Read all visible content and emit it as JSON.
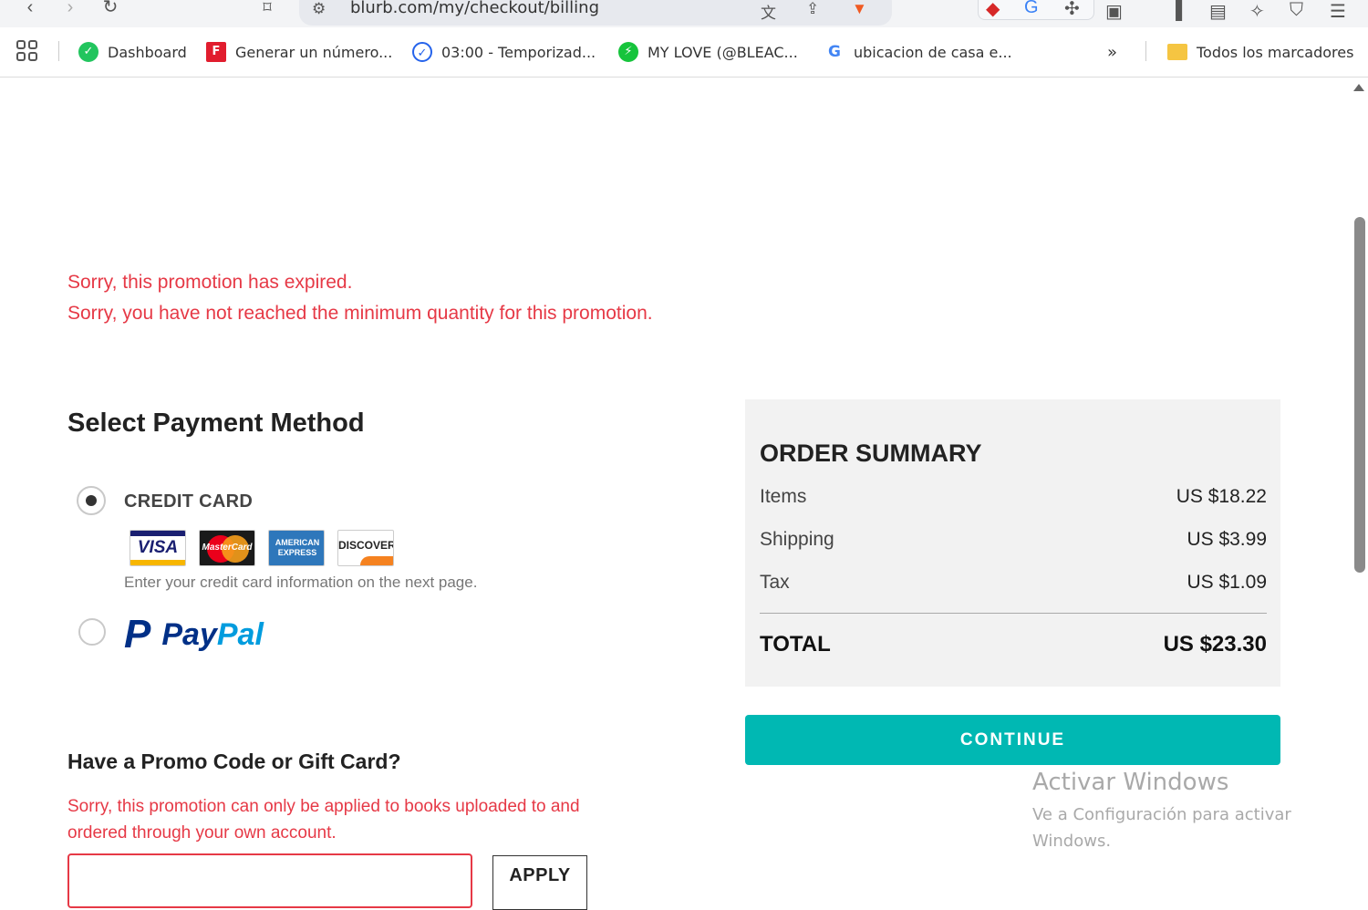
{
  "browser": {
    "url": "blurb.com/my/checkout/billing",
    "bookmarks": [
      {
        "label": "Dashboard",
        "color": "#22c55e"
      },
      {
        "label": "Generar un número...",
        "color": "#e11d2e"
      },
      {
        "label": "03:00 - Temporizad...",
        "color": "#2563eb"
      },
      {
        "label": "MY LOVE (@BLEAC...",
        "color": "#16c43c"
      },
      {
        "label": "ubicacion de casa e...",
        "color": "#ffffff"
      }
    ],
    "bookmarks_folder": "Todos los marcadores"
  },
  "alerts": {
    "promo_expired": "Sorry, this promotion has expired.",
    "min_quantity": "Sorry, you have not reached the minimum quantity for this promotion."
  },
  "payment": {
    "title": "Select Payment Method",
    "credit_card_label": "CREDIT CARD",
    "card_brands": {
      "visa": "VISA",
      "mastercard": "MasterCard",
      "amex": "AMERICAN EXPRESS",
      "discover": "DISCOVER"
    },
    "credit_card_note": "Enter your credit card information on the next page.",
    "paypal_pay": "Pay",
    "paypal_pal": "Pal",
    "selected": "credit_card"
  },
  "promo": {
    "title": "Have a Promo Code or Gift Card?",
    "error": "Sorry, this promotion can only be applied to books uploaded to and ordered through your own account.",
    "input_value": "",
    "apply_label": "APPLY"
  },
  "summary": {
    "title": "ORDER SUMMARY",
    "rows": [
      {
        "label": "Items",
        "value": "US $18.22"
      },
      {
        "label": "Shipping",
        "value": "US $3.99"
      },
      {
        "label": "Tax",
        "value": "US $1.09"
      }
    ],
    "total_label": "TOTAL",
    "total_value": "US $23.30",
    "continue_label": "CONTINUE"
  },
  "watermark": {
    "line1": "Activar Windows",
    "line2": "Ve a Configuración para activar Windows."
  },
  "colors": {
    "error": "#e63946",
    "accent": "#00b8b3",
    "summary_bg": "#f2f2f2"
  }
}
